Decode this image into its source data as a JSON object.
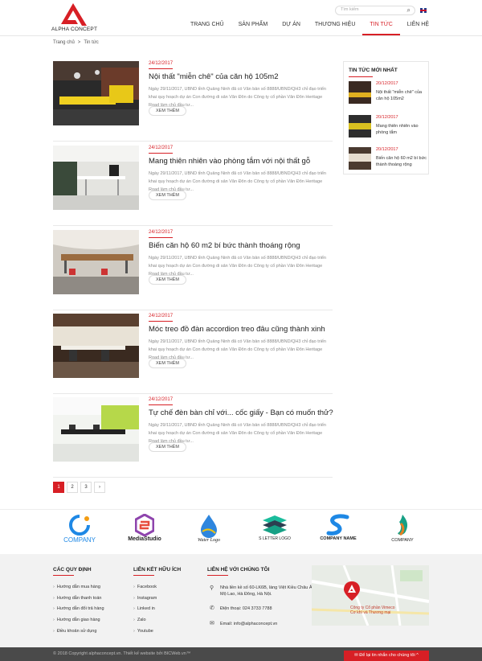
{
  "header": {
    "logo_text": "ALPHA CONCEPT",
    "search_placeholder": "Tìm kiếm",
    "nav": [
      "TRANG CHỦ",
      "SẢN PHẨM",
      "DỰ ÁN",
      "THƯƠNG HIỆU",
      "TIN TỨC",
      "LIÊN HỆ"
    ],
    "active_nav": "TIN TỨC"
  },
  "breadcrumb": {
    "home": "Trang chủ",
    "sep": ">",
    "current": "Tin tức"
  },
  "articles": [
    {
      "date": "24/12/2017",
      "title": "Nội thất \"miễn chê\" của căn hộ 105m2",
      "desc": "Ngày 29/11/2017, UBND tỉnh Quảng Ninh đã có Văn bản số 8888/UBND/QH3 chỉ đạo triển khai quy hoạch dự án Con đường di sản Văn Đôn do Công ty cổ phần Văn Đôn Heritage Road làm chủ đầu tư...",
      "button": "XEM THÊM"
    },
    {
      "date": "24/12/2017",
      "title": "Mang thiên nhiên vào phòng tắm với nội thất gỗ",
      "desc": "Ngày 29/11/2017, UBND tỉnh Quảng Ninh đã có Văn bản số 8888/UBND/QH3 chỉ đạo triển khai quy hoạch dự án Con đường di sản Văn Đôn do Công ty cổ phần Văn Đôn Heritage Road làm chủ đầu tư...",
      "button": "XEM THÊM"
    },
    {
      "date": "24/12/2017",
      "title": "Biến căn hộ 60 m2 bí bức thành thoáng rộng",
      "desc": "Ngày 29/11/2017, UBND tỉnh Quảng Ninh đã có Văn bản số 8888/UBND/QH3 chỉ đạo triển khai quy hoạch dự án Con đường di sản Văn Đôn do Công ty cổ phần Văn Đôn Heritage Road làm chủ đầu tư...",
      "button": "XEM THÊM"
    },
    {
      "date": "24/12/2017",
      "title": "Móc treo đồ đàn accordion treo đâu cũng thành xinh",
      "desc": "Ngày 29/11/2017, UBND tỉnh Quảng Ninh đã có Văn bản số 8888/UBND/QH3 chỉ đạo triển khai quy hoạch dự án Con đường di sản Văn Đôn do Công ty cổ phần Văn Đôn Heritage Road làm chủ đầu tư...",
      "button": "XEM THÊM"
    },
    {
      "date": "24/12/2017",
      "title": "Tự chế đèn bàn chỉ với... cốc giấy - Bạn có muốn thử?",
      "desc": "Ngày 29/11/2017, UBND tỉnh Quảng Ninh đã có Văn bản số 8888/UBND/QH3 chỉ đạo triển khai quy hoạch dự án Con đường di sản Văn Đôn do Công ty cổ phần Văn Đôn Heritage Road làm chủ đầu tư...",
      "button": "XEM THÊM"
    }
  ],
  "sidebar": {
    "title": "TIN TỨC MỚI NHẤT",
    "items": [
      {
        "date": "20/12/2017",
        "title": "Nội thất \"miễn chê\" của căn hộ 105m2"
      },
      {
        "date": "20/12/2017",
        "title": "Mang thiên nhiên vào phòng tắm"
      },
      {
        "date": "20/12/2017",
        "title": "Biến căn hộ 60 m2 bí bức thành thoáng rộng"
      }
    ]
  },
  "pagination": {
    "pages": [
      "1",
      "2",
      "3",
      "›"
    ],
    "active": "1"
  },
  "partners": [
    "COMPANY",
    "MediaStudio",
    "Water Logo",
    "S LETTER LOGO",
    "COMPANY NAME",
    "COMPANY"
  ],
  "footer": {
    "col1": {
      "title": "CÁC QUY ĐỊNH",
      "links": [
        "Hướng dẫn mua hàng",
        "Hướng dẫn thanh toán",
        "Hướng dẫn đổi trả hàng",
        "Hướng dẫn giao hàng",
        "Điều khoản sử dụng"
      ]
    },
    "col2": {
      "title": "LIÊN KẾT HỮU ÍCH",
      "links": [
        "Facebook",
        "Instagram",
        "Linked in",
        "Zalo",
        "Youtube"
      ]
    },
    "col3": {
      "title": "LIÊN HỆ VỚI CHÚNG TÔI",
      "address": "Nhà liền kề số 60-LK6B, làng Việt Kiều Châu Âu, Mộ Lao, Hà Đông, Hà Nội.",
      "phone": "Điện thoại: 024 3733 7788",
      "email": "Email: info@alphaconcept.vn"
    },
    "map_label_1": "Công ty Cổ phần Vimeco",
    "map_label_2": "Cơ khí và Thương mại"
  },
  "bottom": {
    "copyright": "© 2018 Copyright alphaconcept.vn. Thiết kế website bởi BICWeb.vn™",
    "chat": "✉ Để lại tin nhắn cho chúng tôi ^"
  },
  "colors": {
    "accent": "#d71f25",
    "footer_bg": "#f2f2f2",
    "bottom_bg": "#4a4a4a"
  }
}
